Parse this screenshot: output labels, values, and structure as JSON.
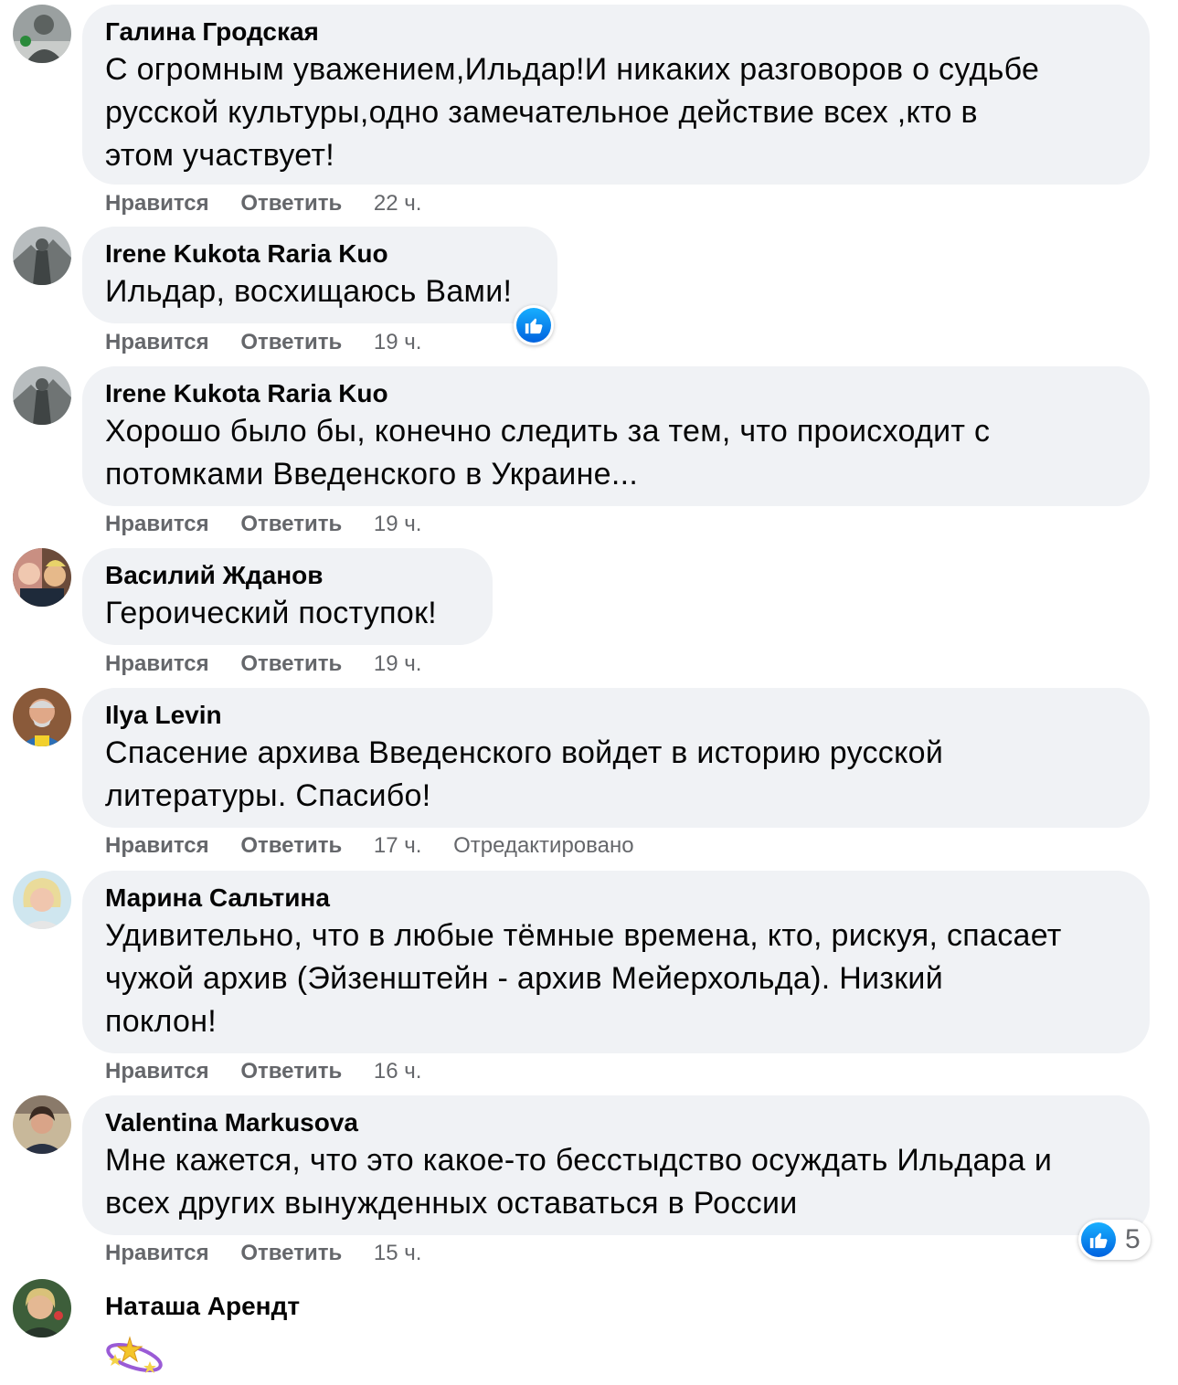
{
  "comments": [
    {
      "author": "Галина Гродская",
      "lines": [
        "С огромным уважением,Ильдар!И никаких разговоров о судьбе",
        "русской культуры,одно замечательное действие всех ,кто в",
        "этом участвует!"
      ],
      "like_label": "Нравится",
      "reply_label": "Ответить",
      "time": "22 ч."
    },
    {
      "author": "Irene Kukota Raria Kuo",
      "lines": [
        "Ильдар, восхищаюсь Вами!"
      ],
      "like_label": "Нравится",
      "reply_label": "Ответить",
      "time": "19 ч."
    },
    {
      "author": "Irene Kukota Raria Kuo",
      "lines": [
        "Хорошо было бы, конечно следить за тем, что происходит с",
        "потомками Введенского в Украине..."
      ],
      "like_label": "Нравится",
      "reply_label": "Ответить",
      "time": "19 ч."
    },
    {
      "author": "Василий Жданов",
      "lines": [
        "Героический поступок!"
      ],
      "like_label": "Нравится",
      "reply_label": "Ответить",
      "time": "19 ч."
    },
    {
      "author": "Ilya Levin",
      "lines": [
        "Спасение архива Введенского войдет в историю русской",
        "литературы. Спасибо!"
      ],
      "like_label": "Нравится",
      "reply_label": "Ответить",
      "time": "17 ч.",
      "edited_label": "Отредактировано"
    },
    {
      "author": "Марина Сальтина",
      "lines": [
        "Удивительно, что в любые тёмные времена, кто, рискуя, спасает",
        "чужой архив (Эйзенштейн - архив Мейерхольда). Низкий",
        "поклон!"
      ],
      "like_label": "Нравится",
      "reply_label": "Ответить",
      "time": "16 ч."
    },
    {
      "author": "Valentina Markusova",
      "lines": [
        "Мне кажется, что это какое-то бесстыдство осуждать Ильдара и",
        "всех других вынужденных оставаться в России"
      ],
      "like_label": "Нравится",
      "reply_label": "Ответить",
      "time": "15 ч.",
      "reaction_count": "5"
    },
    {
      "author": "Наташа Арендт",
      "sticker": "sparkles-sticker"
    }
  ],
  "icons": {
    "reaction": "like-icon"
  },
  "colors": {
    "bubble": "#f0f2f5",
    "meta_text": "#65676b",
    "like_blue": "#1877f2"
  }
}
